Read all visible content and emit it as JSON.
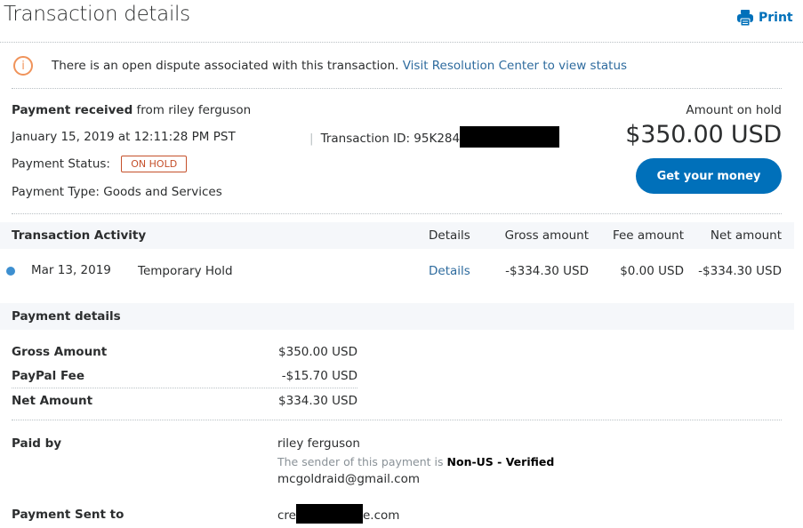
{
  "header": {
    "title": "Transaction details",
    "print_label": "Print"
  },
  "alert": {
    "icon": "info-icon",
    "message": "There is an open dispute associated with this transaction.",
    "link_text": "Visit Resolution Center to view status"
  },
  "summary": {
    "received_bold": "Payment received",
    "received_rest": " from riley ferguson",
    "datetime": "January 15, 2019 at 12:11:28 PM PST",
    "transaction_id_label": "Transaction ID: 95K284",
    "status_label": "Payment Status:",
    "status_badge": "ON HOLD",
    "type_line": "Payment Type: Goods and Services",
    "hold_label": "Amount on hold",
    "hold_amount": "$350.00 USD",
    "get_money_button": "Get your money"
  },
  "activity": {
    "title": "Transaction Activity",
    "columns": [
      "Details",
      "Gross amount",
      "Fee amount",
      "Net amount"
    ],
    "rows": [
      {
        "date": "Mar 13, 2019",
        "description": "Temporary Hold",
        "details_link": "Details",
        "gross": "-$334.30 USD",
        "fee": "$0.00 USD",
        "net": "-$334.30 USD"
      }
    ]
  },
  "payment_details": {
    "title": "Payment details",
    "lines": [
      {
        "label": "Gross Amount",
        "value": "$350.00 USD"
      },
      {
        "label": "PayPal Fee",
        "value": "-$15.70 USD"
      },
      {
        "label": "Net Amount",
        "value": "$334.30 USD"
      }
    ],
    "paid_by_label": "Paid by",
    "paid_by_name": "riley ferguson",
    "sender_note_prefix": "The sender of this payment is ",
    "sender_note_bold": "Non-US - Verified",
    "paid_by_email": "mcgoldraid@gmail.com",
    "sent_to_label": "Payment Sent to",
    "sent_to_prefix": "cre",
    "sent_to_suffix": "e.com"
  },
  "colors": {
    "accent": "#0070ba",
    "link": "#2e6b9e",
    "alert": "#f0935a",
    "hold_badge": "#c5502b",
    "band": "#f5f7fa",
    "activity_dot": "#3d8fd0"
  }
}
